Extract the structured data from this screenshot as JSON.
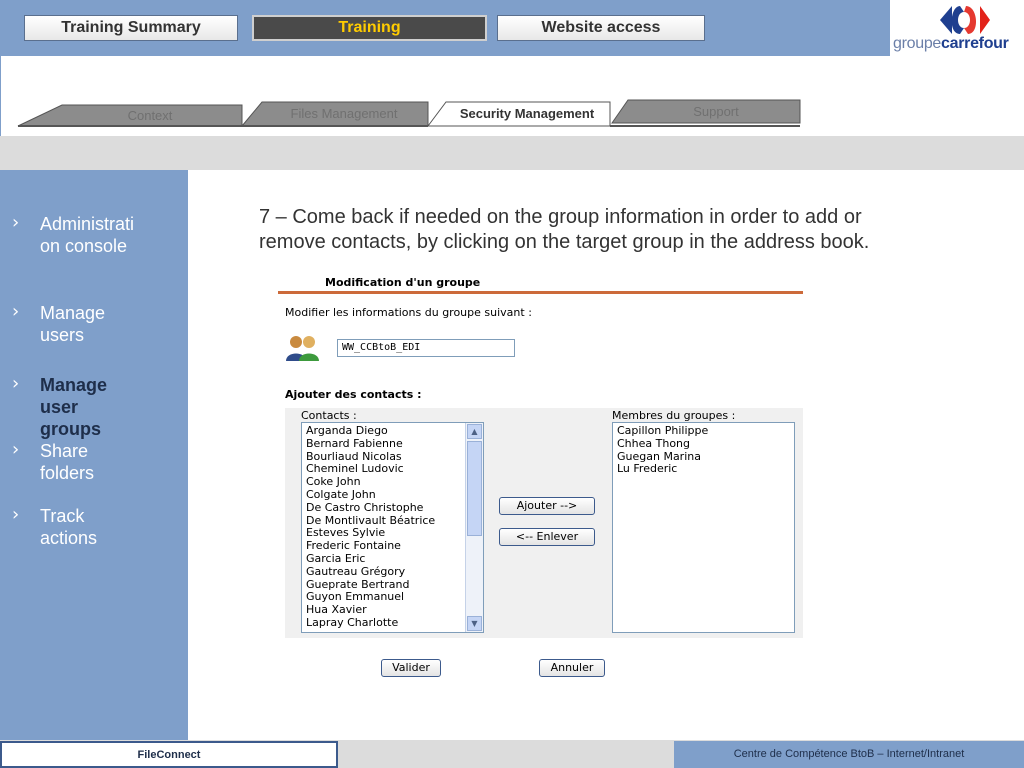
{
  "header": {
    "buttons": [
      "Training Summary",
      "Training",
      "Website access"
    ],
    "active_button": "Training",
    "logo": {
      "prefix": "groupe",
      "brand": "carrefour"
    }
  },
  "tabs": [
    "Context",
    "Files Management",
    "Security Management",
    "Support"
  ],
  "active_tab": "Security Management",
  "sidebar": {
    "items": [
      {
        "label": "Administration console",
        "line1": "Administrati",
        "line2": "on console"
      },
      {
        "label": "Manage users",
        "line1": "Manage",
        "line2": "users"
      },
      {
        "label": "Manage user groups",
        "line1": "Manage",
        "line2": "user",
        "line3": "groups"
      },
      {
        "label": "Share folders",
        "line1": "Share",
        "line2": "folders"
      },
      {
        "label": "Track actions",
        "line1": "Track",
        "line2": "actions"
      }
    ],
    "active_item": "Manage user groups"
  },
  "main": {
    "instruction_line1": "7 – Come back if needed on the group information in order to add or",
    "instruction_line2": "remove contacts, by clicking on the target group in the address book.",
    "form": {
      "title": "Modification d'un groupe",
      "subtitle": "Modifier les informations du groupe suivant :",
      "group_name": "WW_CCBtoB_EDI",
      "add_contacts_title": "Ajouter des contacts :",
      "contacts_label": "Contacts :",
      "members_label": "Membres du groupes :",
      "contacts": [
        "Arganda Diego",
        "Bernard Fabienne",
        "Bourliaud Nicolas",
        "Cheminel Ludovic",
        "Coke John",
        "Colgate John",
        "De Castro Christophe",
        "De Montlivault Béatrice",
        "Esteves Sylvie",
        "Frederic Fontaine",
        "Garcia Eric",
        "Gautreau Grégory",
        "Gueprate Bertrand",
        "Guyon Emmanuel",
        "Hua Xavier",
        "Lapray Charlotte"
      ],
      "members": [
        "Capillon Philippe",
        "Chhea Thong",
        "Guegan Marina",
        "Lu Frederic"
      ],
      "add_button": "Ajouter -->",
      "remove_button": "<-- Enlever",
      "validate_button": "Valider",
      "cancel_button": "Annuler"
    }
  },
  "footer": {
    "left": "FileConnect",
    "right": "Centre de Compétence BtoB – Internet/Intranet"
  },
  "colors": {
    "accent_blue": "#7f9fca",
    "form_rule": "#cc6a3a",
    "active_text": "#ffcc00"
  }
}
